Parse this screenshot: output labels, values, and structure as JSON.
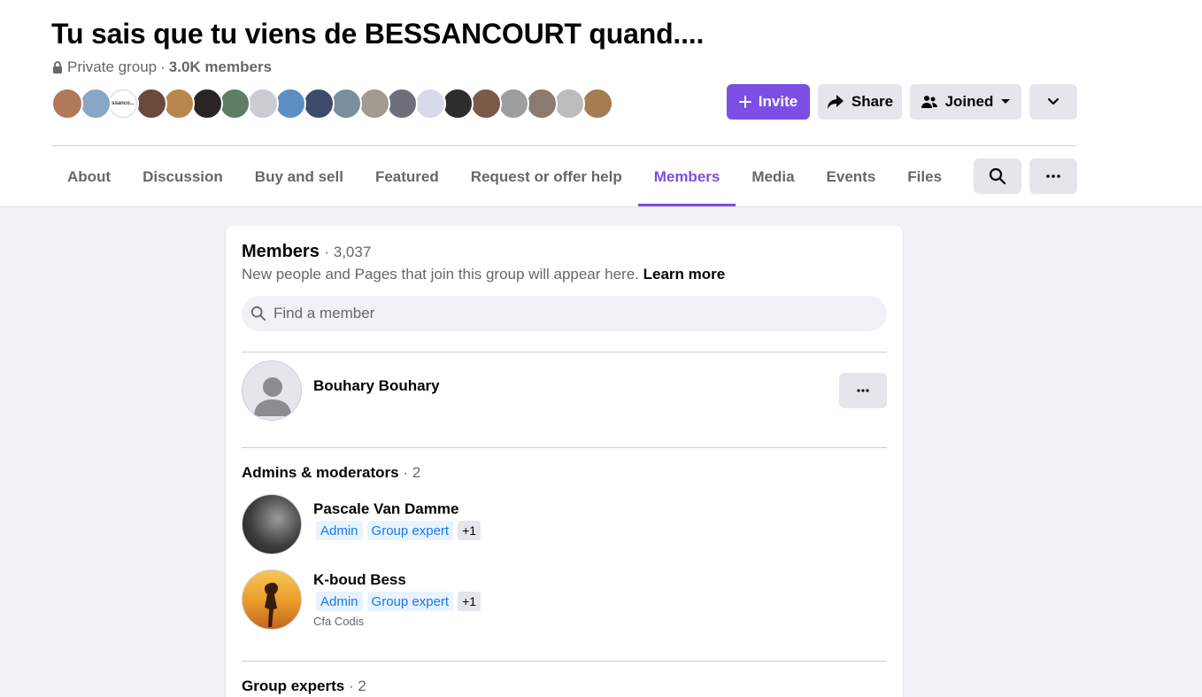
{
  "group": {
    "title": "Tu sais que tu viens de BESSANCOURT quand....",
    "privacy": "Private group",
    "separator": "·",
    "member_count": "3.0K members"
  },
  "avatar_strip": {
    "colors": [
      "#b07a5a",
      "#8aa6c6",
      "#ffffff",
      "#6b4a3c",
      "#b9864e",
      "#2b2424",
      "#5e7d62",
      "#c9ccd1",
      "#5b8fc2",
      "#3e4a6c",
      "#7a8f9e",
      "#a09a90",
      "#6d6f7a",
      "#d7dbe8",
      "#2d2d2d",
      "#7b5a48",
      "#9e9e9e",
      "#8a7a72",
      "#bcbcbc",
      "#a67c52"
    ],
    "center_text": "ssanco..."
  },
  "actions": {
    "invite": "Invite",
    "share": "Share",
    "joined": "Joined"
  },
  "tabs": [
    {
      "label": "About"
    },
    {
      "label": "Discussion"
    },
    {
      "label": "Buy and sell"
    },
    {
      "label": "Featured"
    },
    {
      "label": "Request or offer help"
    },
    {
      "label": "Members",
      "active": true
    },
    {
      "label": "Media"
    },
    {
      "label": "Events"
    },
    {
      "label": "Files"
    }
  ],
  "members_card": {
    "title": "Members",
    "count": "· 3,037",
    "subtitle": "New people and Pages that join this group will appear here.",
    "learn_more": "Learn more",
    "search_placeholder": "Find a member",
    "newest_member": {
      "name": "Bouhary Bouhary"
    },
    "admins_section": {
      "title": "Admins & moderators",
      "count": "· 2"
    },
    "admins": [
      {
        "name": "Pascale Van Damme",
        "badges": [
          "Admin",
          "Group expert"
        ],
        "extra": "+1",
        "sub": ""
      },
      {
        "name": "K-boud Bess",
        "badges": [
          "Admin",
          "Group expert"
        ],
        "extra": "+1",
        "sub": "Cfa Codis"
      }
    ],
    "experts_section": {
      "title": "Group experts",
      "count": "· 2"
    }
  },
  "colors": {
    "accent": "#7c4ee4",
    "badge_text": "#1877f2",
    "badge_bg": "#e7f3ff",
    "secondary_text": "#65676b",
    "button_bg": "#e4e6eb"
  }
}
